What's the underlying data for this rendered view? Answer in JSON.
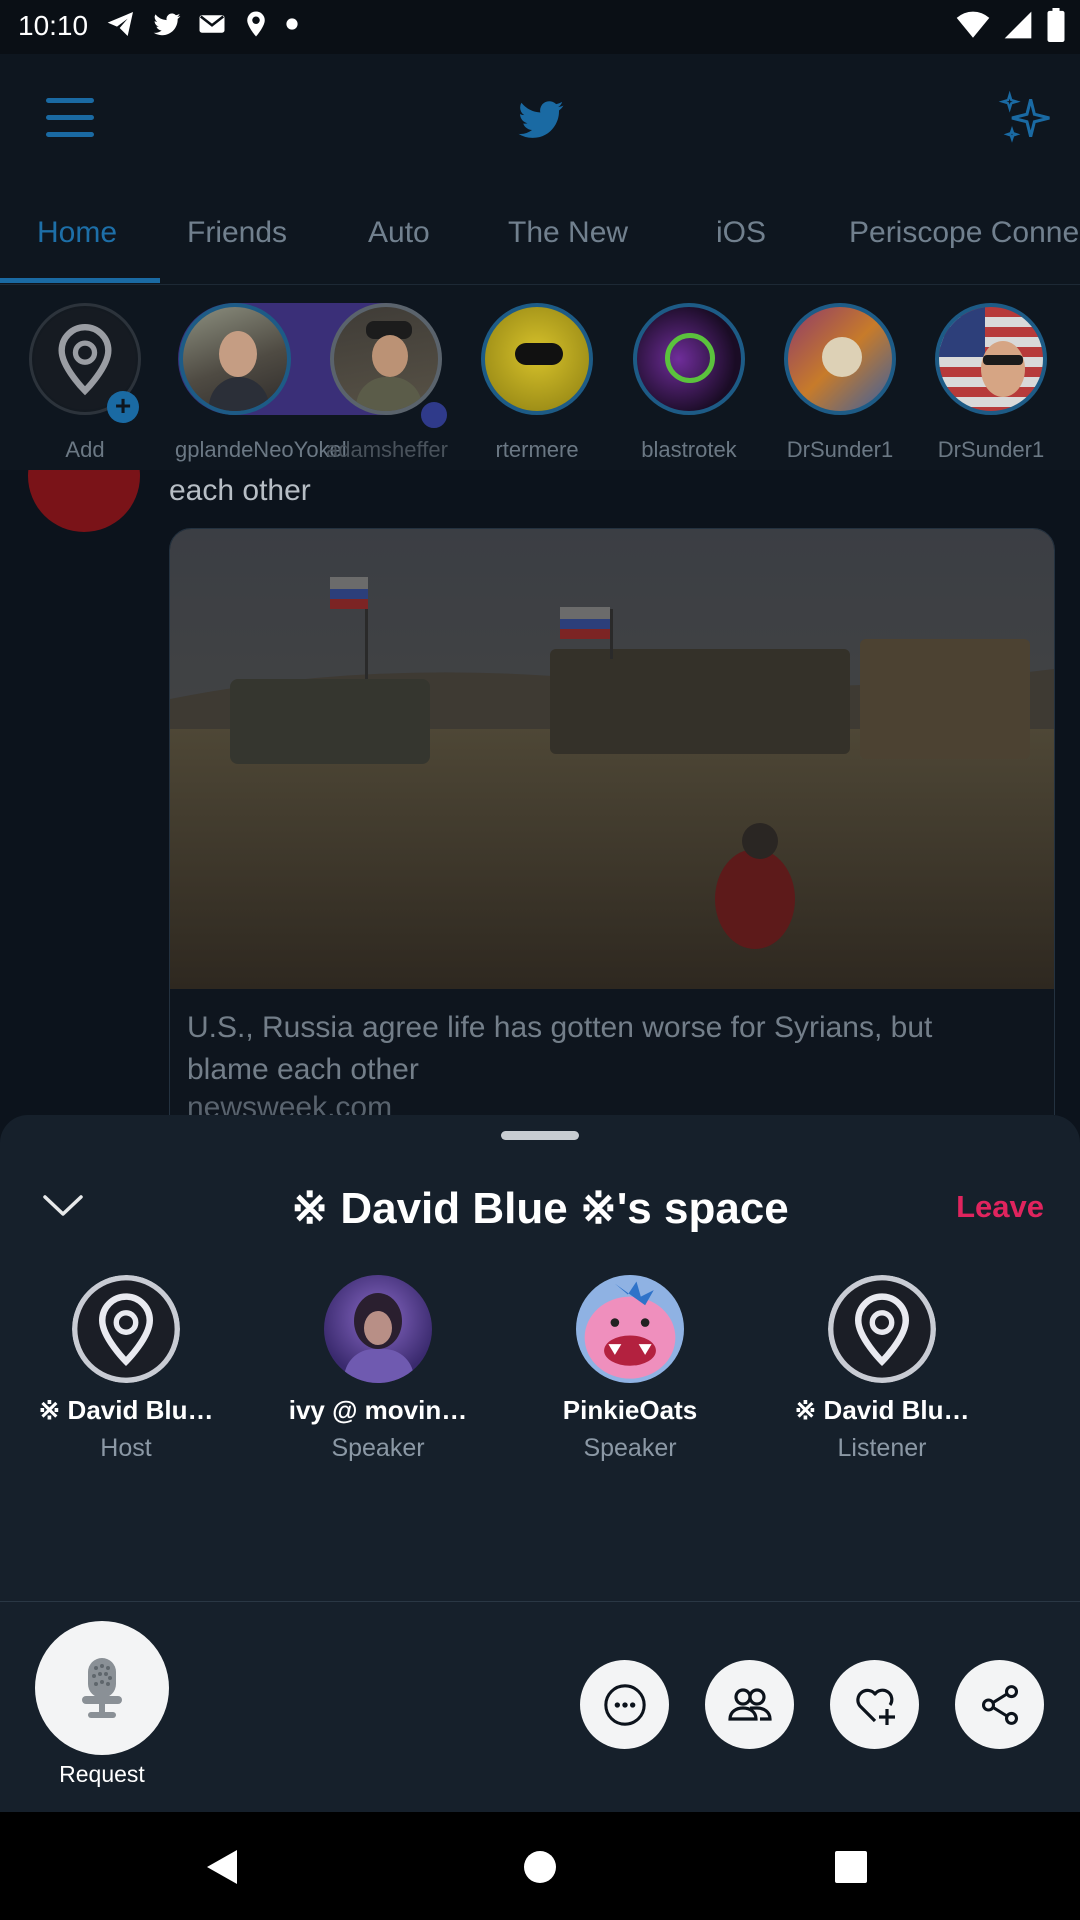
{
  "status_bar": {
    "time": "10:10",
    "left_icons": [
      "telegram-icon",
      "twitter-icon",
      "mail-icon",
      "location-icon",
      "dot-icon"
    ],
    "right_icons": [
      "wifi-icon",
      "signal-icon",
      "battery-icon"
    ]
  },
  "app_bar": {
    "menu_icon": "hamburger-menu-icon",
    "logo_icon": "twitter-bird-icon",
    "sparkle_icon": "sparkle-icon",
    "accent_color": "#1d6fa8"
  },
  "tabs": [
    {
      "label": "Home",
      "active": true
    },
    {
      "label": "Friends"
    },
    {
      "label": "Auto"
    },
    {
      "label": "The New"
    },
    {
      "label": "iOS"
    },
    {
      "label": "Periscope Conne"
    }
  ],
  "fleets": {
    "add_label": "Add",
    "items": [
      {
        "label": "gplandeNeoYokel"
      },
      {
        "label": "adamsheffer"
      },
      {
        "label": "rtermere"
      },
      {
        "label": "blastrotek"
      },
      {
        "label": "DrSunder1"
      },
      {
        "label": "DrSunder1"
      }
    ]
  },
  "feed": {
    "tweet_text_tail": "each other",
    "link_card": {
      "caption": "U.S., Russia agree life has gotten worse for Syrians, but blame each other",
      "domain": "newsweek.com"
    }
  },
  "space": {
    "title": "※ David Blue ※'s space",
    "leave_label": "Leave",
    "leave_color": "#e0245e",
    "participants": [
      {
        "name": "※ David Blu…",
        "role": "Host"
      },
      {
        "name": "ivy @ movin…",
        "role": "Speaker"
      },
      {
        "name": "PinkieOats",
        "role": "Speaker"
      },
      {
        "name": "※ David Blu…",
        "role": "Listener"
      }
    ],
    "request_label": "Request",
    "actions": [
      "more-icon",
      "people-icon",
      "heart-plus-icon",
      "share-icon"
    ]
  },
  "nav_bar": {
    "buttons": [
      "back-icon",
      "home-icon",
      "recents-icon"
    ]
  }
}
